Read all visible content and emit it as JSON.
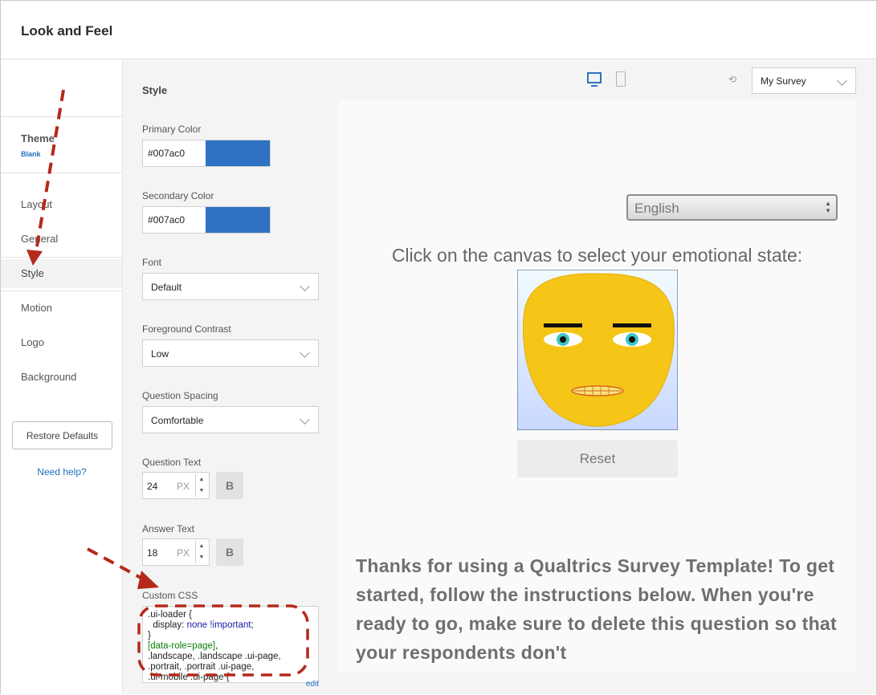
{
  "header": {
    "title": "Look and Feel"
  },
  "nav": {
    "theme_label": "Theme",
    "theme_value": "Blank",
    "items": [
      {
        "label": "Layout",
        "active": false
      },
      {
        "label": "General",
        "active": false
      },
      {
        "label": "Style",
        "active": true
      },
      {
        "label": "Motion",
        "active": false
      },
      {
        "label": "Logo",
        "active": false
      },
      {
        "label": "Background",
        "active": false
      }
    ],
    "restore_label": "Restore Defaults",
    "help_label": "Need help?"
  },
  "style": {
    "title": "Style",
    "primary_color_label": "Primary Color",
    "primary_color_value": "#007ac0",
    "secondary_color_label": "Secondary Color",
    "secondary_color_value": "#007ac0",
    "font_label": "Font",
    "font_value": "Default",
    "contrast_label": "Foreground Contrast",
    "contrast_value": "Low",
    "spacing_label": "Question Spacing",
    "spacing_value": "Comfortable",
    "question_text_label": "Question Text",
    "question_text_size": "24",
    "answer_text_label": "Answer Text",
    "answer_text_size": "18",
    "unit": "PX",
    "bold_label": "B",
    "custom_css_label": "Custom CSS",
    "edit_label": "edit"
  },
  "preview": {
    "survey_select": "My Survey",
    "language": "English",
    "question": "Click on the canvas to select your emotional state:",
    "reset_label": "Reset",
    "thanks_text": "Thanks for using a Qualtrics Survey Template! To get started, follow the instructions below. When you're ready to go, make sure to delete this question so that your respondents don't"
  },
  "colors": {
    "accent": "#2f72c4",
    "link": "#1f6fbf",
    "annotation": "#b5291c",
    "face": "#f5c518"
  }
}
